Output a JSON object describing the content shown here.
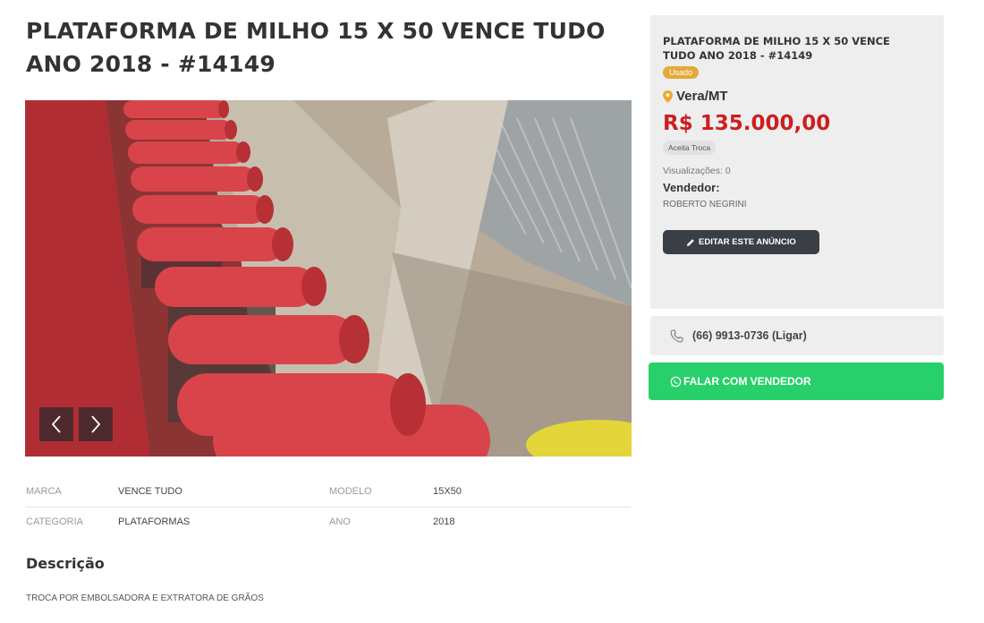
{
  "listing": {
    "title": "PLATAFORMA DE MILHO 15 X 50 VENCE TUDO ANO 2018 - #14149",
    "condition_badge": "Usado",
    "location": "Vera/MT",
    "price": "R$ 135.000,00",
    "trade_badge": "Aceita Troca",
    "views": "Visualizações: 0",
    "seller_label": "Vendedor:",
    "seller_name": "ROBERTO NEGRINI",
    "edit_button": "EDITAR ESTE ANÚNCIO",
    "phone": "(66) 9913-0736 (Ligar)",
    "whatsapp_button": "FALAR COM VENDEDOR"
  },
  "gallery": {
    "prev_icon": "chevron-left-icon",
    "next_icon": "chevron-right-icon"
  },
  "specs": [
    {
      "k1": "MARCA",
      "v1": "VENCE TUDO",
      "k2": "MODELO",
      "v2": "15X50"
    },
    {
      "k1": "CATEGORIA",
      "v1": "PLATAFORMAS",
      "k2": "ANO",
      "v2": "2018"
    }
  ],
  "description": {
    "heading": "Descrição",
    "text": "TROCA POR EMBOLSADORA E EXTRATORA DE GRÃOS"
  },
  "colors": {
    "price": "#cc1f1f",
    "used_badge": "#e5a93b",
    "location_pin": "#f0a92b",
    "whatsapp": "#27d06a",
    "edit_button": "#3a3f45"
  }
}
